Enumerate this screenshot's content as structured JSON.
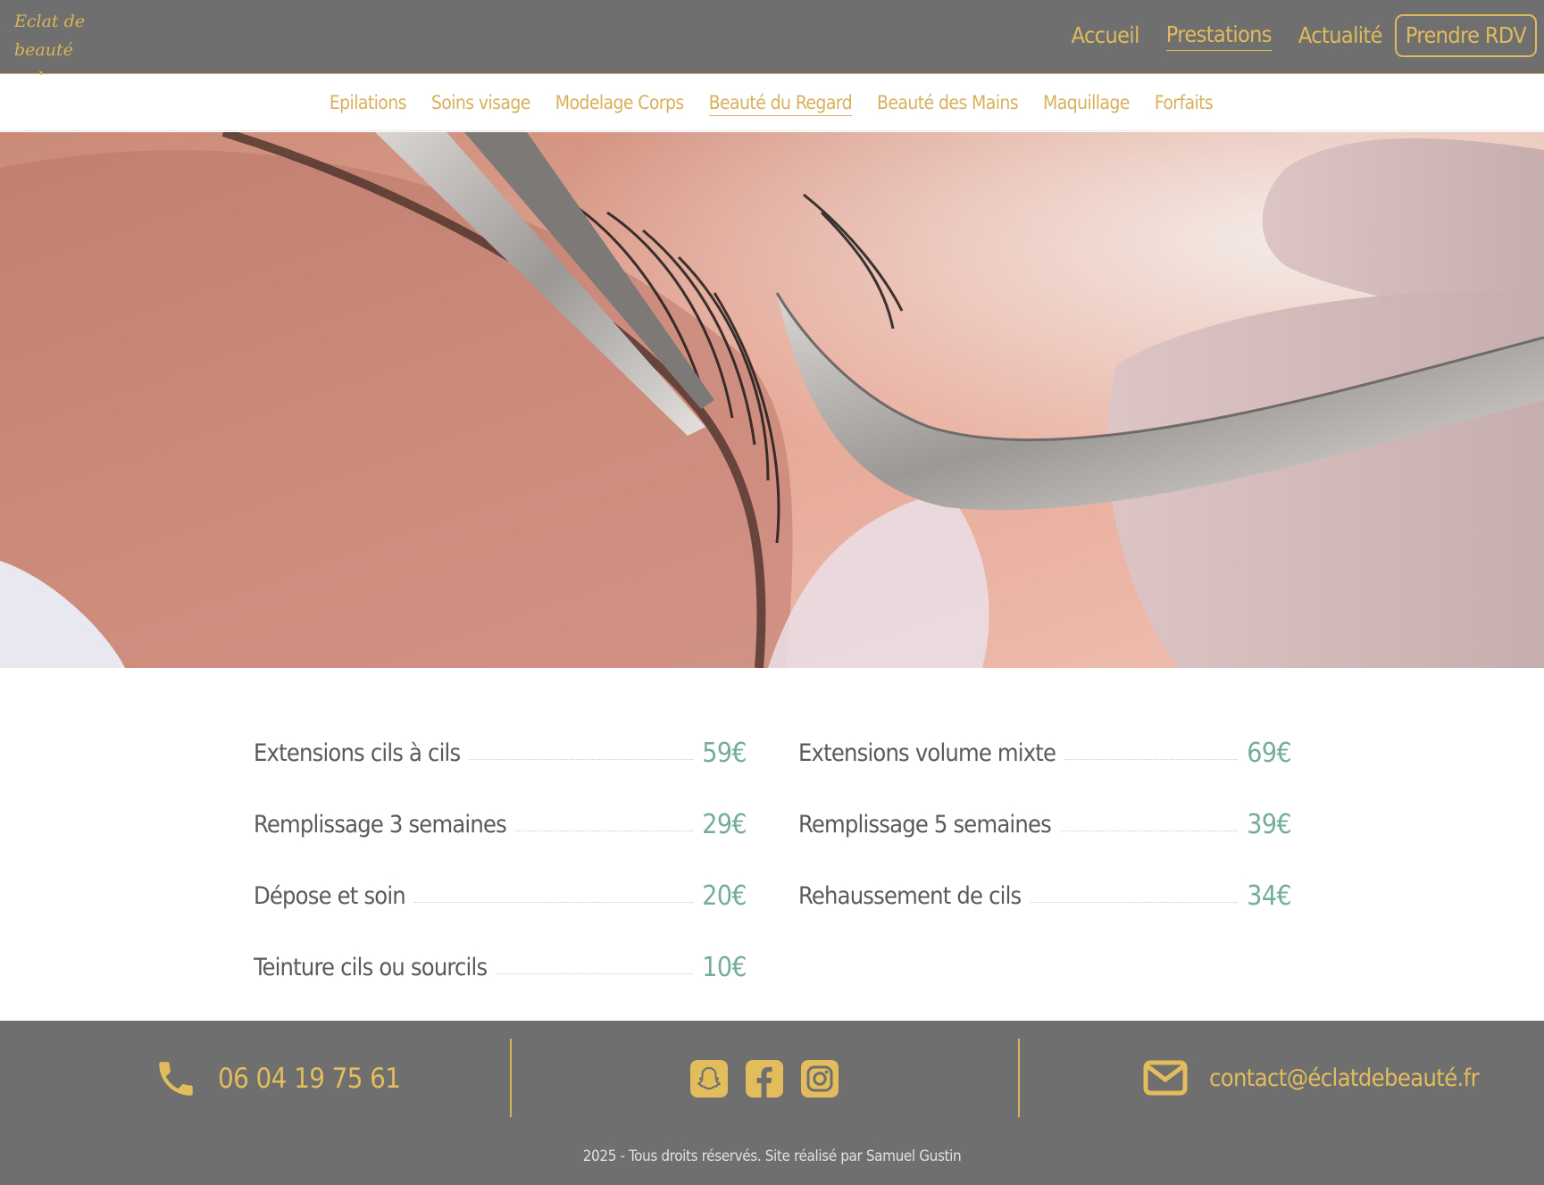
{
  "header": {
    "logo_line1": "Eclat de beauté",
    "logo_line2": "by Virginie",
    "nav": {
      "home": "Accueil",
      "services": "Prestations",
      "news": "Actualité",
      "book": "Prendre RDV"
    }
  },
  "subnav": {
    "items": [
      "Epilations",
      "Soins visage",
      "Modelage Corps",
      "Beauté du Regard",
      "Beauté des Mains",
      "Maquillage",
      "Forfaits"
    ],
    "active_index": 3
  },
  "prices": {
    "left": [
      {
        "name": "Extensions cils à cils",
        "price": "59€"
      },
      {
        "name": "Remplissage 3 semaines",
        "price": "29€"
      },
      {
        "name": "Dépose et soin",
        "price": "20€"
      },
      {
        "name": "Teinture cils ou sourcils",
        "price": "10€"
      }
    ],
    "right": [
      {
        "name": "Extensions volume mixte",
        "price": "69€"
      },
      {
        "name": "Remplissage 5 semaines",
        "price": "39€"
      },
      {
        "name": "Rehaussement de cils",
        "price": "34€"
      }
    ]
  },
  "footer": {
    "phone": "06 04 19 75 61",
    "email": "contact@éclatdebeauté.fr",
    "copyright": "2025 - Tous droits réservés. Site réalisé par Samuel Gustin",
    "icons": [
      "phone-icon",
      "snapchat-icon",
      "facebook-icon",
      "instagram-icon",
      "envelope-icon"
    ]
  },
  "colors": {
    "header_bg": "#6f6f6f",
    "gold": "#e0bb5c",
    "price_green": "#74ad9a",
    "text_gray": "#5a5a5a"
  }
}
